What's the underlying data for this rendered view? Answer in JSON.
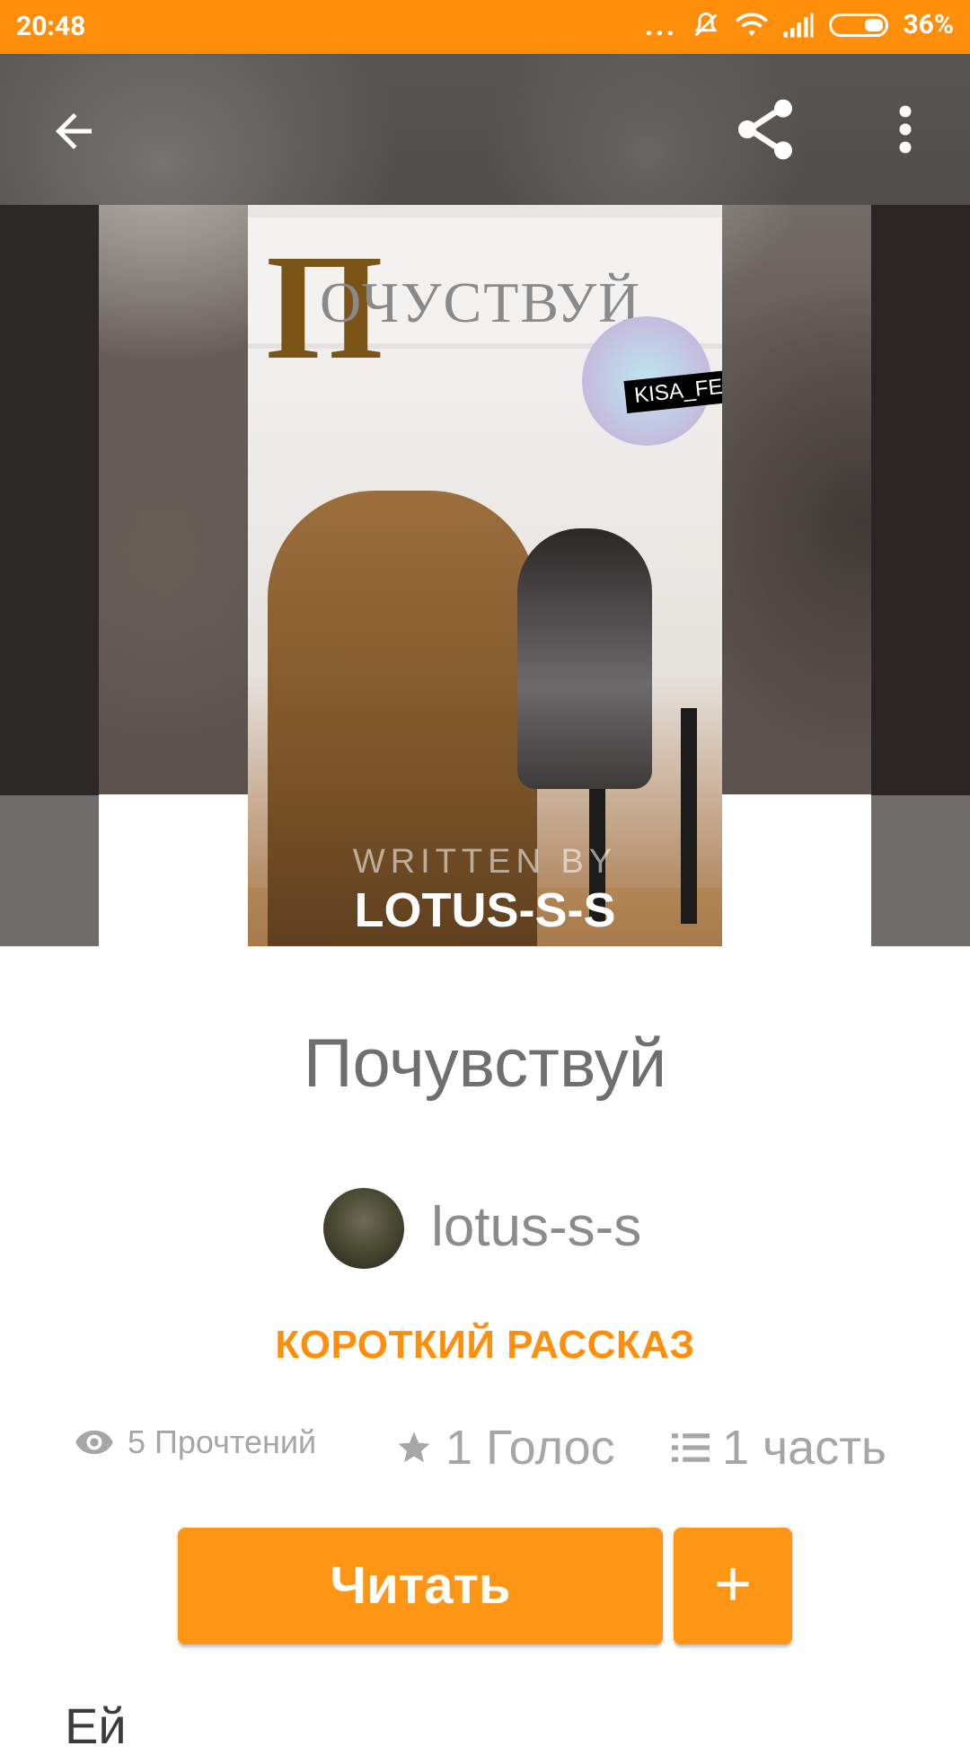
{
  "status_bar": {
    "time": "20:48",
    "dots": "...",
    "battery_percent": "36%"
  },
  "toolbar": {
    "back_icon": "arrow-left-icon",
    "share_icon": "share-icon",
    "more_icon": "more-vert-icon"
  },
  "cover": {
    "big_letter": "П",
    "title_rest": "ОЧУСТВУЙ",
    "badge_text": "KISA_FELIX",
    "written_by": "WRITTEN BY",
    "author": "LOTUS-S-S"
  },
  "story": {
    "title": "Почувствуй",
    "author": "lotus-s-s",
    "category": "КОРОТКИЙ РАССКАЗ",
    "stats": {
      "reads": "5 Прочтений",
      "votes": "1 Голос",
      "parts": "1 часть"
    },
    "read_button": "Читать",
    "add_button": "+",
    "description_start": "Ей"
  },
  "colors": {
    "accent": "#ff8f0a",
    "button": "#ff9514",
    "text_muted": "#a6a6a6"
  }
}
